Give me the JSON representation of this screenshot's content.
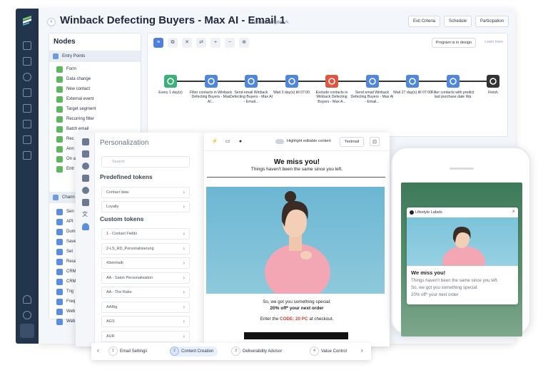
{
  "header": {
    "title": "Winback Defecting Buyers - Max AI - Email 1",
    "add_description": "Add a description",
    "exit_criteria": "Exit Criteria",
    "schedule": "Schedule",
    "participation": "Participation"
  },
  "nodes": {
    "title": "Nodes",
    "entry_points": "Entry Points",
    "entry_items": [
      "Form",
      "Data change",
      "New contact",
      "External event",
      "Target segment",
      "Recurring filter",
      "Batch email",
      "Rec",
      "Ann",
      "On a",
      "Entr"
    ],
    "channels": "Chann",
    "channel_items": [
      "Sen",
      "API",
      "Dum",
      "Save",
      "Set",
      "Rese",
      "CRM",
      "CRM",
      "Trig",
      "Freq",
      "Web",
      "Web"
    ]
  },
  "canvas": {
    "program_status": "Program is in design",
    "learn_more": "Learn more",
    "steps": [
      "Every 1 day(s)",
      "Filter contacts in Winback Defecting Buyers - Max AI...",
      "Send email Winback Defecting Buyers - Max AI - Email...",
      "Wait 3 day(s) till 07:00",
      "Exclude contacts in Winback Defecting Buyers - Max A...",
      "Send email Winback Defecting Buyers - Max AI - Email...",
      "Wait 27 day(s) till 07:00",
      "Filter contacts with predict last purchase date Wa",
      "Finish"
    ],
    "step_colors": [
      "#3ab07a",
      "#4f86e0",
      "#4f86e0",
      "#4f86e0",
      "#e0553f",
      "#4f86e0",
      "#4f86e0",
      "#4f86e0",
      "#333333"
    ]
  },
  "personalization": {
    "title": "Personalization",
    "search_placeholder": "Search",
    "predefined": "Predefined tokens",
    "predefined_tokens": [
      "Contact data",
      "Loyalty"
    ],
    "custom": "Custom tokens",
    "custom_tokens": [
      "1 - Contact Fields",
      "2-LS_RD_Personalisierung",
      "43einhalb",
      "AA - Salon Personalisation",
      "AA - The Rake",
      "AABig",
      "AGS",
      "AUR"
    ]
  },
  "email": {
    "highlight": "Highlight editable content",
    "testmail": "Testmail",
    "heading": "We miss you!",
    "subheading": "Things haven't been the same since you left.",
    "line1": "So, we got you something special:",
    "line2": "20% off* your next order",
    "code_prefix": "Enter the",
    "code": "CODE: 20 PC",
    "code_suffix": "at checkout."
  },
  "steps": [
    {
      "n": "1",
      "label": "Email Settings"
    },
    {
      "n": "2",
      "label": "Content Creation"
    },
    {
      "n": "3",
      "label": "Deliverability Advisor"
    },
    {
      "n": "4",
      "label": "Value Control"
    }
  ],
  "phone": {
    "brand": "Lifestyle Labels",
    "title": "We miss you!",
    "lines": [
      "Things haven't been the same since you left.",
      "So, we got you something special:",
      "20% off* your next order"
    ]
  }
}
